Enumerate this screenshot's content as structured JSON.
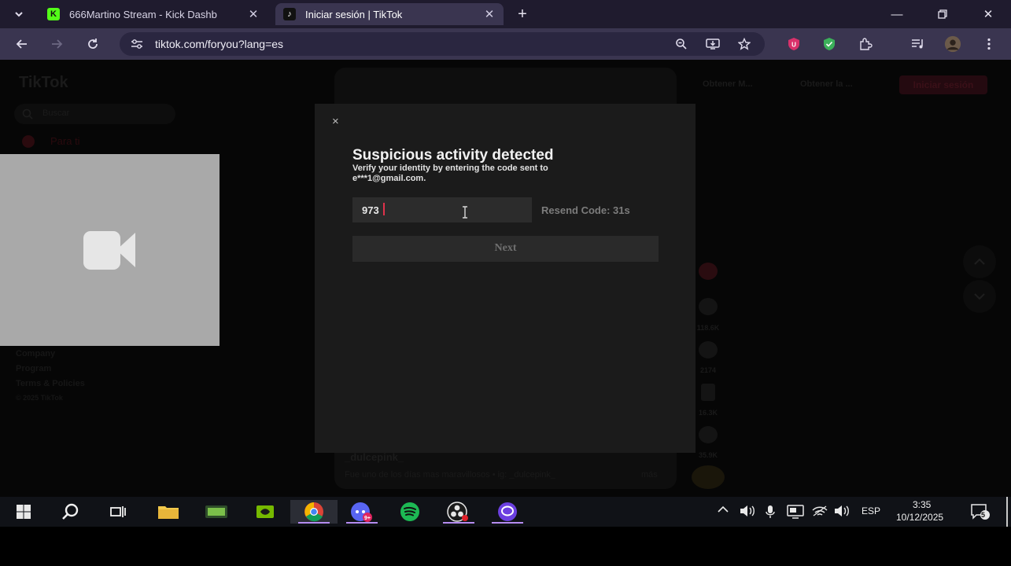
{
  "browser": {
    "tabs": [
      {
        "title": "666Martino Stream - Kick Dashb",
        "favicon": "K"
      },
      {
        "title": "Iniciar sesión | TikTok",
        "favicon": "♪"
      }
    ],
    "new_tab": "+",
    "url": "tiktok.com/foryou?lang=es"
  },
  "tiktok_bg": {
    "logo": "TikTok",
    "search_placeholder": "Buscar",
    "nav_for_you": "Para ti",
    "top_action_a": "Obtener M...",
    "top_action_b": "Obtener la ...",
    "login_button": "Iniciar sesión",
    "footer_links": [
      "Company",
      "Program",
      "Terms & Policies",
      "© 2025 TikTok"
    ],
    "video_author": "_dulcepink_",
    "video_caption": "Fue uno de los días mas maravillosos  •  ig: _dulcepink_",
    "video_more": "más",
    "counts": [
      "118.6K",
      "2174",
      "16.3K",
      "35.9K"
    ]
  },
  "modal": {
    "close": "×",
    "title": "Suspicious activity detected",
    "subtitle": "Verify your identity by entering the code sent to e***1@gmail.com.",
    "code_value": "973",
    "resend": "Resend Code: 31s",
    "next_button": "Next"
  },
  "taskbar": {
    "language": "ESP",
    "time": "3:35",
    "date": "10/12/2025",
    "notifications": "5"
  },
  "colors": {
    "browser_bg": "#3a3550",
    "tiktok_red": "#fe2c55",
    "modal_bg": "#1b1b1b"
  }
}
